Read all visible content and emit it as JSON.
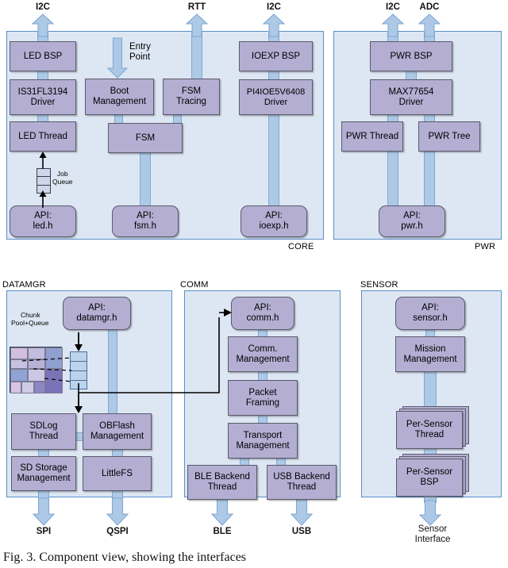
{
  "figure": {
    "caption": "Fig. 3.  Component view, showing the interfaces",
    "groups": [
      {
        "id": "core",
        "label": "CORE",
        "io_top": [
          "I2C",
          "RTT",
          "I2C"
        ],
        "blocks": [
          "LED BSP",
          "IS31FL3194 Driver",
          "LED Thread",
          "API: led.h",
          "Boot Management",
          "FSM",
          "API: fsm.h",
          "FSM Tracing",
          "IOEXP BSP",
          "PI4IOE5V6408 Driver",
          "API: ioexp.h"
        ],
        "annotations": [
          "Entry Point",
          "Job Queue"
        ]
      },
      {
        "id": "pwr",
        "label": "PWR",
        "io_top": [
          "I2C",
          "ADC"
        ],
        "blocks": [
          "PWR BSP",
          "MAX77654 Driver",
          "PWR Thread",
          "PWR Tree",
          "API: pwr.h"
        ]
      },
      {
        "id": "datamgr",
        "label": "DATAMGR",
        "io_bottom": [
          "SPI",
          "QSPI"
        ],
        "blocks": [
          "API: datamgr.h",
          "SDLog Thread",
          "OBFlash Management",
          "SD Storage Management",
          "LittleFS"
        ],
        "annotations": [
          "Chunk Pool+Queue"
        ]
      },
      {
        "id": "comm",
        "label": "COMM",
        "io_bottom": [
          "BLE",
          "USB"
        ],
        "blocks": [
          "API: comm.h",
          "Comm. Management",
          "Packet Framing",
          "Transport Management",
          "BLE Backend Thread",
          "USB Backend Thread"
        ]
      },
      {
        "id": "sensor",
        "label": "SENSOR",
        "io_bottom": [
          "Sensor Interface"
        ],
        "blocks": [
          "API: sensor.h",
          "Mission Management",
          "Per-Sensor Thread",
          "Per-Sensor BSP"
        ]
      }
    ]
  },
  "colors": {
    "panel_fill": "#dde7f3",
    "panel_border": "#5b8fc9",
    "block_fill": "#b3aed2",
    "block_border": "#5a5a6a",
    "connector_fill": "#adc9e6",
    "connector_border": "#7fa8d4",
    "arrow_fill": "#adc9e6",
    "text": "#000000"
  },
  "core": {
    "label": "CORE",
    "io": {
      "i2c_led": "I2C",
      "rtt": "RTT",
      "i2c_ioexp": "I2C"
    },
    "entry_point": "Entry\nPoint",
    "entry_point_line1": "Entry",
    "entry_point_line2": "Point",
    "job_queue_line1": "Job",
    "job_queue_line2": "Queue",
    "led_bsp": "LED BSP",
    "led_driver_line1": "IS31FL3194",
    "led_driver_line2": "Driver",
    "led_thread": "LED Thread",
    "led_api_line1": "API:",
    "led_api_line2": "led.h",
    "boot_line1": "Boot",
    "boot_line2": "Management",
    "fsm": "FSM",
    "fsm_api_line1": "API:",
    "fsm_api_line2": "fsm.h",
    "fsm_tracing_line1": "FSM",
    "fsm_tracing_line2": "Tracing",
    "ioexp_bsp": "IOEXP BSP",
    "ioexp_driver_line1": "PI4IOE5V6408",
    "ioexp_driver_line2": "Driver",
    "ioexp_api_line1": "API:",
    "ioexp_api_line2": "ioexp.h"
  },
  "pwr": {
    "label": "PWR",
    "io": {
      "i2c": "I2C",
      "adc": "ADC"
    },
    "pwr_bsp": "PWR BSP",
    "max_driver_line1": "MAX77654",
    "max_driver_line2": "Driver",
    "pwr_thread": "PWR Thread",
    "pwr_tree": "PWR Tree",
    "pwr_api_line1": "API:",
    "pwr_api_line2": "pwr.h"
  },
  "datamgr": {
    "label": "DATAMGR",
    "io": {
      "spi": "SPI",
      "qspi": "QSPI"
    },
    "api_line1": "API:",
    "api_line2": "datamgr.h",
    "chunk_line1": "Chunk",
    "chunk_line2": "Pool+Queue",
    "sdlog_line1": "SDLog",
    "sdlog_line2": "Thread",
    "obflash_line1": "OBFlash",
    "obflash_line2": "Management",
    "sdstorage_line1": "SD Storage",
    "sdstorage_line2": "Management",
    "littlefs": "LittleFS"
  },
  "comm": {
    "label": "COMM",
    "io": {
      "ble": "BLE",
      "usb": "USB"
    },
    "api_line1": "API:",
    "api_line2": "comm.h",
    "mgmt_line1": "Comm.",
    "mgmt_line2": "Management",
    "packet_line1": "Packet",
    "packet_line2": "Framing",
    "transport_line1": "Transport",
    "transport_line2": "Management",
    "ble_backend_line1": "BLE Backend",
    "ble_backend_line2": "Thread",
    "usb_backend_line1": "USB Backend",
    "usb_backend_line2": "Thread"
  },
  "sensor": {
    "label": "SENSOR",
    "io": {
      "iface_line1": "Sensor",
      "iface_line2": "Interface"
    },
    "api_line1": "API:",
    "api_line2": "sensor.h",
    "mission_line1": "Mission",
    "mission_line2": "Management",
    "thread_line1": "Per-Sensor",
    "thread_line2": "Thread",
    "bsp_line1": "Per-Sensor",
    "bsp_line2": "BSP"
  }
}
